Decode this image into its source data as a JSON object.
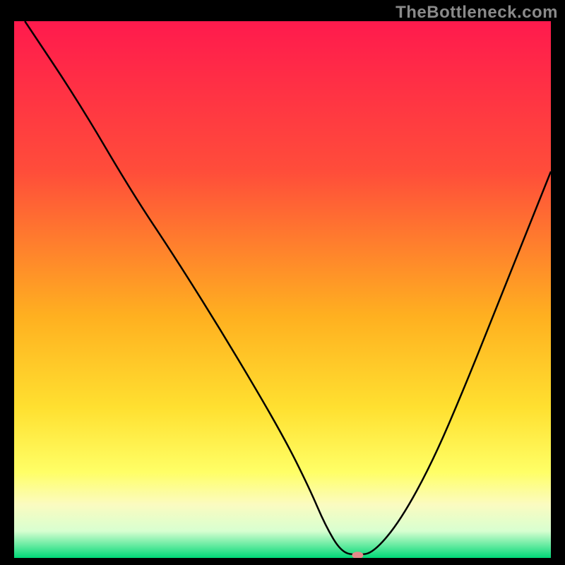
{
  "watermark": "TheBottleneck.com",
  "chart_data": {
    "type": "line",
    "title": "",
    "xlabel": "",
    "ylabel": "",
    "xlim": [
      0,
      100
    ],
    "ylim": [
      0,
      100
    ],
    "gradient_stops": [
      {
        "offset": 0,
        "color": "#ff1a4d"
      },
      {
        "offset": 28,
        "color": "#ff4d3a"
      },
      {
        "offset": 55,
        "color": "#ffb020"
      },
      {
        "offset": 72,
        "color": "#ffe030"
      },
      {
        "offset": 84,
        "color": "#ffff66"
      },
      {
        "offset": 90,
        "color": "#fbfbc0"
      },
      {
        "offset": 95,
        "color": "#d8ffd0"
      },
      {
        "offset": 100,
        "color": "#00d977"
      }
    ],
    "series": [
      {
        "name": "bottleneck-curve",
        "x": [
          2,
          12,
          22,
          30,
          40,
          50,
          55,
          58,
          61,
          64,
          67,
          72,
          78,
          84,
          90,
          96,
          100
        ],
        "y": [
          100,
          85,
          68,
          56,
          40,
          23,
          13,
          6,
          1,
          0.5,
          1,
          7,
          18,
          32,
          47,
          62,
          72
        ]
      }
    ],
    "marker": {
      "x": 64,
      "y": 0.5,
      "color": "#e38a8a",
      "rx": 8,
      "ry": 5
    }
  }
}
